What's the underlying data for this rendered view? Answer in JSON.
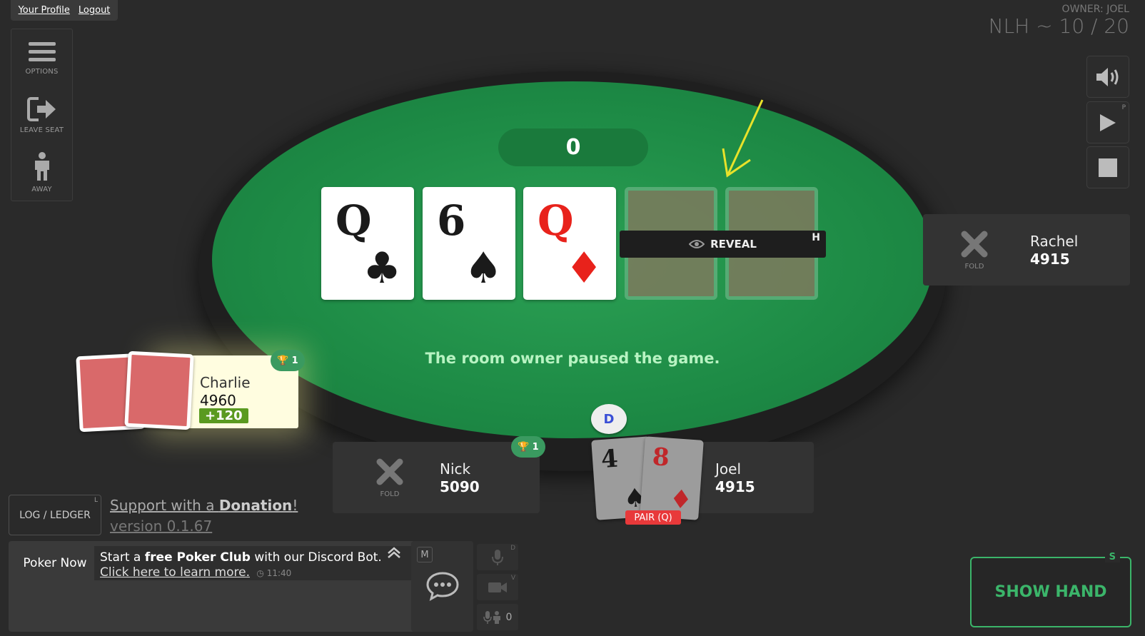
{
  "top_links": {
    "profile": "Your Profile",
    "logout": "Logout"
  },
  "side_menu": {
    "options": "OPTIONS",
    "leave_seat": "LEAVE SEAT",
    "away": "AWAY"
  },
  "header": {
    "owner": "OWNER: JOEL",
    "stakes": "NLH ~ 10 / 20"
  },
  "controls": {
    "play_hotkey": "P"
  },
  "table": {
    "pot": "0",
    "board": [
      {
        "rank": "Q",
        "suit": "♣",
        "color": "black"
      },
      {
        "rank": "6",
        "suit": "♠",
        "color": "black"
      },
      {
        "rank": "Q",
        "suit": "♦",
        "color": "red"
      }
    ],
    "reveal_label": "REVEAL",
    "reveal_hotkey": "H",
    "status_message": "The room owner paused the game.",
    "dealer_button": "D"
  },
  "players": {
    "rachel": {
      "name": "Rachel",
      "stack": "4915",
      "status": "FOLD"
    },
    "charlie": {
      "name": "Charlie",
      "stack": "4960",
      "winnings": "+120",
      "trophies": "1"
    },
    "nick": {
      "name": "Nick",
      "stack": "5090",
      "status": "FOLD",
      "trophies": "1"
    },
    "joel": {
      "name": "Joel",
      "stack": "4915",
      "cards": [
        {
          "rank": "4",
          "suit": "♠",
          "color": "black"
        },
        {
          "rank": "8",
          "suit": "♦",
          "color": "red"
        }
      ],
      "hand_label": "PAIR (Q)"
    }
  },
  "bottom": {
    "log_label": "LOG / LEDGER",
    "log_hotkey": "L",
    "support_prefix": "Support with a ",
    "support_bold": "Donation",
    "support_suffix": "!",
    "version": "version 0.1.67"
  },
  "chat": {
    "sender": "Poker Now",
    "text_prefix": "Start a ",
    "text_bold": "free Poker Club",
    "text_suffix": " with our Discord Bot.",
    "link": "Click here to learn more.",
    "time": "11:40",
    "hotkey": "M"
  },
  "media": {
    "mic_hotkey": "D",
    "video_hotkey": "V",
    "listeners": "0"
  },
  "show_hand": {
    "label": "SHOW HAND",
    "hotkey": "S"
  },
  "colors": {
    "felt": "#1d8a45",
    "accent": "#3bb56a",
    "fold_red": "#e8393a"
  }
}
